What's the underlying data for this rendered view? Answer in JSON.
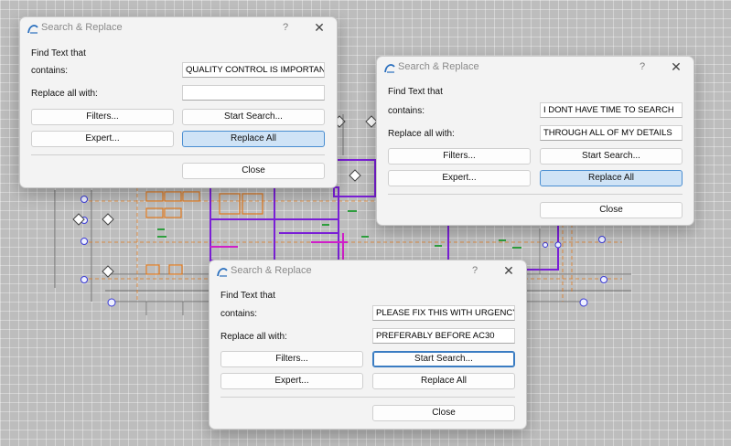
{
  "dialog_common": {
    "title": "Search & Replace",
    "help": "?",
    "close": "✕",
    "find_heading": "Find Text that",
    "contains_label": "contains:",
    "replace_label": "Replace all with:",
    "filters_label": "Filters...",
    "start_search_label": "Start Search...",
    "expert_label": "Expert...",
    "replace_all_label": "Replace All",
    "close_label": "Close"
  },
  "dialog1": {
    "contains_value": "QUALITY CONTROL IS IMPORTANT",
    "replace_value": ""
  },
  "dialog2": {
    "contains_value": "I DONT HAVE TIME TO SEARCH",
    "replace_value": "THROUGH ALL OF MY DETAILS"
  },
  "dialog3": {
    "contains_value": "PLEASE FIX THIS WITH URGENCY",
    "replace_value": "PREFERABLY BEFORE AC30"
  },
  "colors": {
    "accent": "#3a7cc2",
    "plan_purple": "#7a1fd6",
    "plan_orange": "#e07a1e",
    "plan_green": "#2e9e3e",
    "plan_magenta": "#d01fc8"
  }
}
